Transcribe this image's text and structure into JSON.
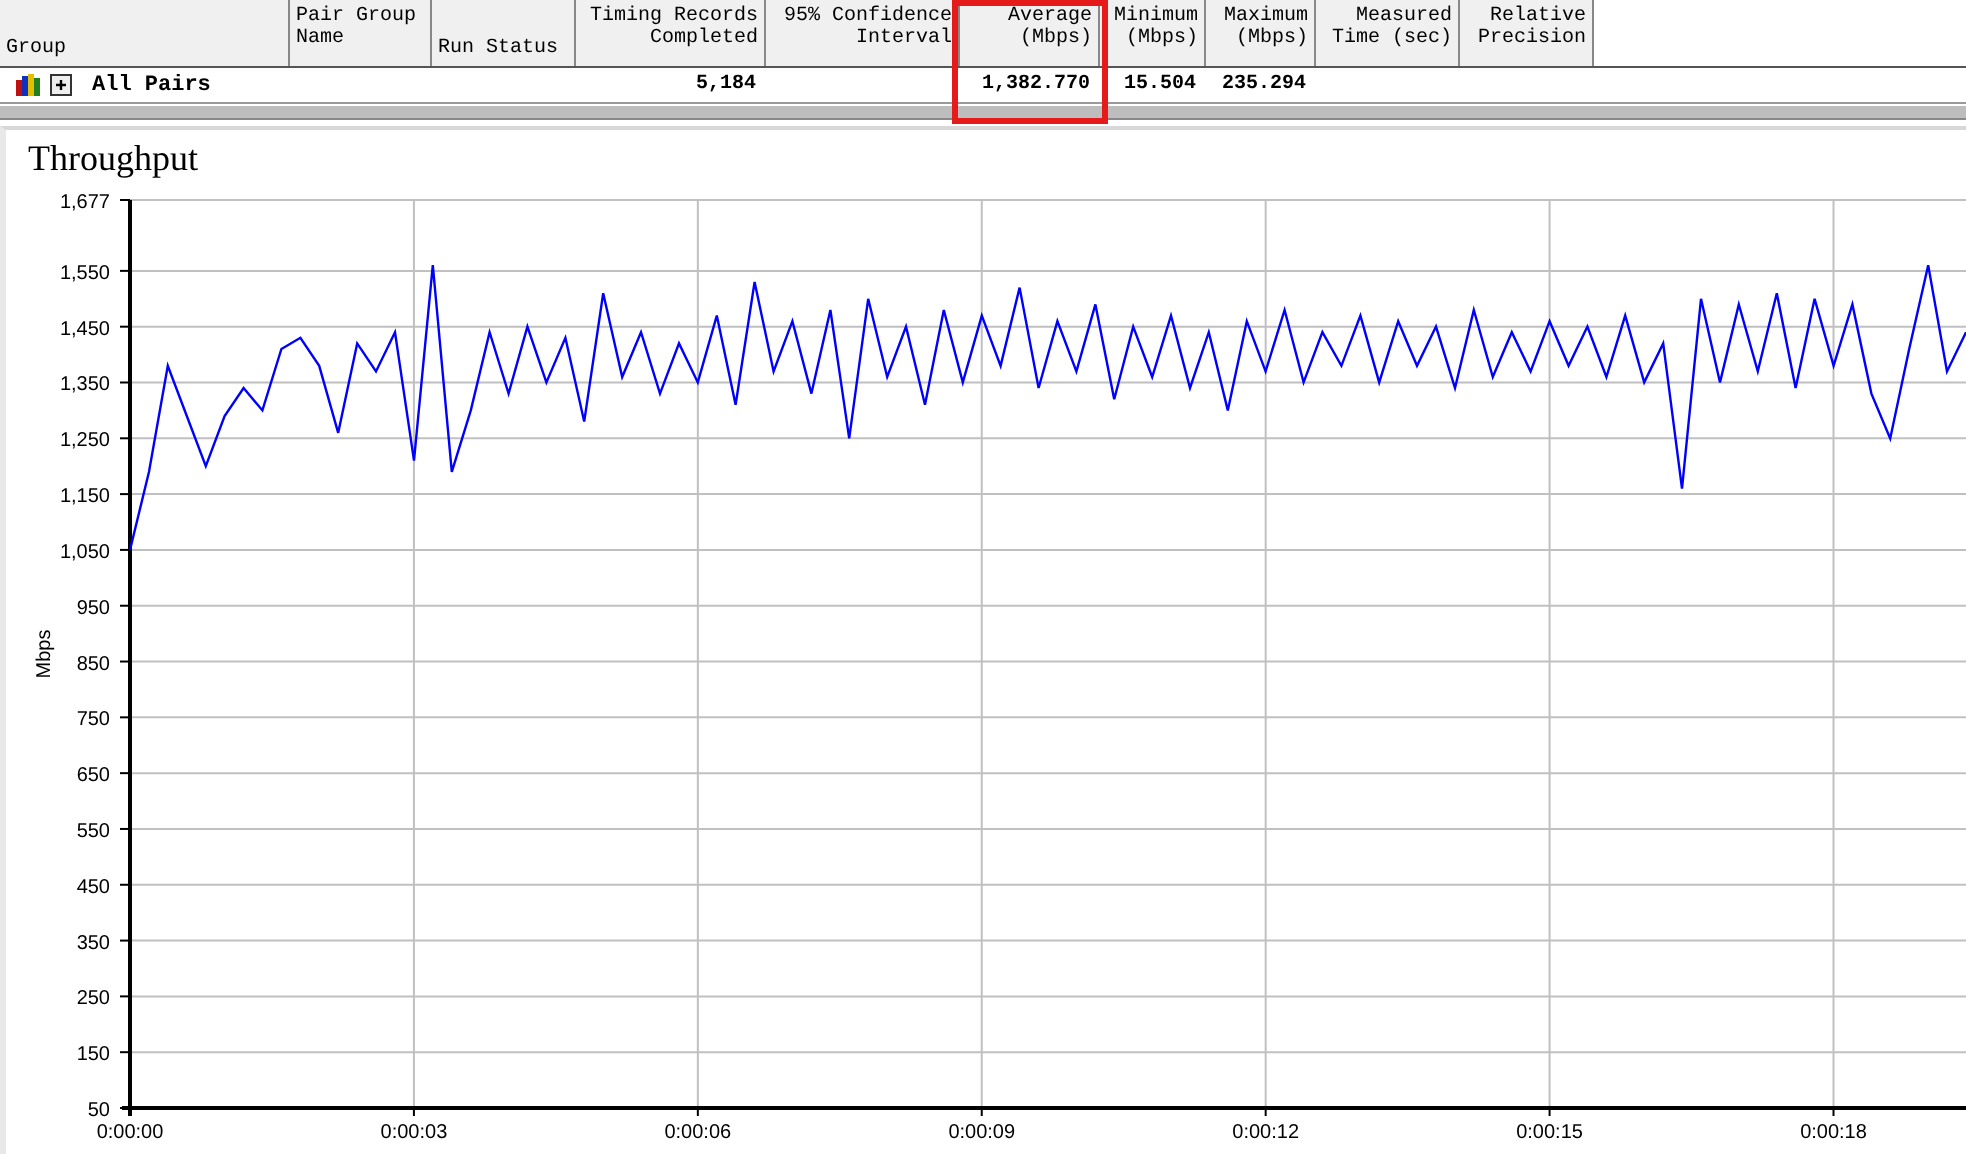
{
  "table": {
    "columns": [
      {
        "label": "Group",
        "kind": "text",
        "highlighted": false
      },
      {
        "label": "Pair Group\nName",
        "kind": "text",
        "highlighted": false
      },
      {
        "label": "Run Status",
        "kind": "text",
        "highlighted": false
      },
      {
        "label": "Timing Records\nCompleted",
        "kind": "number",
        "highlighted": false
      },
      {
        "label": "95% Confidence\nInterval",
        "kind": "number",
        "highlighted": false
      },
      {
        "label": "Average\n(Mbps)",
        "kind": "number",
        "highlighted": true
      },
      {
        "label": "Minimum\n(Mbps)",
        "kind": "number",
        "highlighted": false
      },
      {
        "label": "Maximum\n(Mbps)",
        "kind": "number",
        "highlighted": false
      },
      {
        "label": "Measured\nTime (sec)",
        "kind": "number",
        "highlighted": false
      },
      {
        "label": "Relative\nPrecision",
        "kind": "number",
        "highlighted": false
      }
    ],
    "rows": [
      {
        "expanded": false,
        "cells": [
          "All Pairs",
          "",
          "",
          "5,184",
          "",
          "1,382.770",
          "15.504",
          "235.294",
          "",
          ""
        ]
      }
    ]
  },
  "chart": {
    "chart_data": {
      "type": "line",
      "title": "Throughput",
      "ylabel": "Mbps",
      "grid": true,
      "xlim": [
        0,
        19.4
      ],
      "ylim": [
        50,
        1677
      ],
      "xticks": [
        {
          "value": 0,
          "label": "0:00:00"
        },
        {
          "value": 3,
          "label": "0:00:03"
        },
        {
          "value": 6,
          "label": "0:00:06"
        },
        {
          "value": 9,
          "label": "0:00:09"
        },
        {
          "value": 12,
          "label": "0:00:12"
        },
        {
          "value": 15,
          "label": "0:00:15"
        },
        {
          "value": 18,
          "label": "0:00:18"
        }
      ],
      "yticks": [
        50,
        150,
        250,
        350,
        450,
        550,
        650,
        750,
        850,
        950,
        {
          "value": 1050,
          "label": "1,050"
        },
        {
          "value": 1150,
          "label": "1,150"
        },
        {
          "value": 1250,
          "label": "1,250"
        },
        {
          "value": 1350,
          "label": "1,350"
        },
        {
          "value": 1450,
          "label": "1,450"
        },
        {
          "value": 1550,
          "label": "1,550"
        },
        {
          "value": 1677,
          "label": "1,677"
        }
      ],
      "x": [
        0,
        0.2,
        0.4,
        0.6,
        0.8,
        1,
        1.2,
        1.4,
        1.6,
        1.8,
        2,
        2.2,
        2.4,
        2.6,
        2.8,
        3,
        3.2,
        3.4,
        3.6,
        3.8,
        4,
        4.2,
        4.4,
        4.6,
        4.8,
        5,
        5.2,
        5.4,
        5.6,
        5.8,
        6,
        6.2,
        6.4,
        6.6,
        6.8,
        7,
        7.2,
        7.4,
        7.6,
        7.8,
        8,
        8.2,
        8.4,
        8.6,
        8.8,
        9,
        9.2,
        9.4,
        9.6,
        9.8,
        10,
        10.2,
        10.4,
        10.6,
        10.8,
        11,
        11.2,
        11.4,
        11.6,
        11.8,
        12,
        12.2,
        12.4,
        12.6,
        12.8,
        13,
        13.2,
        13.4,
        13.6,
        13.8,
        14,
        14.2,
        14.4,
        14.6,
        14.8,
        15,
        15.2,
        15.4,
        15.6,
        15.8,
        16,
        16.2,
        16.4,
        16.6,
        16.8,
        17,
        17.2,
        17.4,
        17.6,
        17.8,
        18,
        18.2,
        18.4,
        18.6,
        18.8,
        19,
        19.2,
        19.4
      ],
      "series": [
        {
          "color": "#0000ff",
          "values": [
            1050,
            1190,
            1380,
            1290,
            1200,
            1290,
            1340,
            1300,
            1410,
            1430,
            1380,
            1260,
            1420,
            1370,
            1440,
            1210,
            1560,
            1190,
            1300,
            1440,
            1330,
            1450,
            1350,
            1430,
            1280,
            1510,
            1360,
            1440,
            1330,
            1420,
            1350,
            1470,
            1310,
            1530,
            1370,
            1460,
            1330,
            1480,
            1250,
            1500,
            1360,
            1450,
            1310,
            1480,
            1350,
            1470,
            1380,
            1520,
            1340,
            1460,
            1370,
            1490,
            1320,
            1450,
            1360,
            1470,
            1340,
            1440,
            1300,
            1460,
            1370,
            1480,
            1350,
            1440,
            1380,
            1470,
            1350,
            1460,
            1380,
            1450,
            1340,
            1480,
            1360,
            1440,
            1370,
            1460,
            1380,
            1450,
            1360,
            1470,
            1350,
            1420,
            1160,
            1500,
            1350,
            1490,
            1370,
            1510,
            1340,
            1500,
            1380,
            1490,
            1330,
            1250,
            1410,
            1560,
            1370,
            1440
          ]
        }
      ]
    }
  }
}
